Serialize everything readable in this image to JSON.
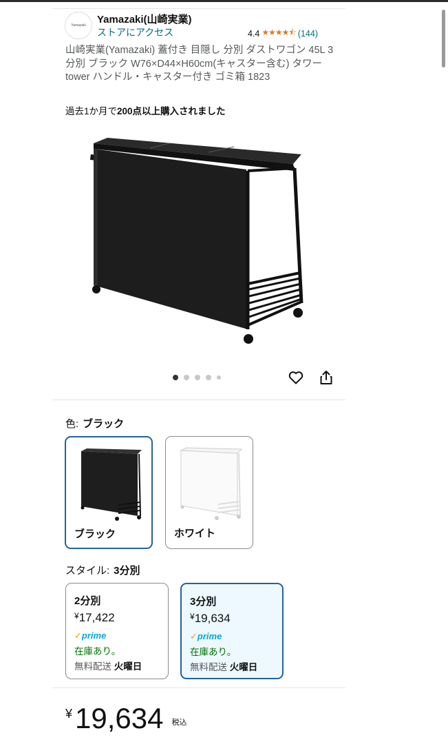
{
  "brand": {
    "logo_text": "Yamazaki",
    "name": "Yamazaki(山崎実業)",
    "store_link": "ストアにアクセス"
  },
  "rating": {
    "value": "4.4",
    "stars": "★★★★⯪",
    "count": "(144)"
  },
  "product": {
    "title": "山崎実業(Yamazaki) 蓋付き 目隠し 分別 ダストワゴン 45L 3分別 ブラック W76×D44×H60cm(キャスター含む) タワー tower ハンドル・キャスター付き ゴミ箱 1823",
    "bought_prefix": "過去1か月で",
    "bought_bold": "200点以上購入されました"
  },
  "carousel": {
    "total": 5,
    "active": 0
  },
  "color": {
    "label": "色:",
    "selected": "ブラック",
    "options": [
      {
        "label": "ブラック",
        "color": "#1e1e1e",
        "selected": true
      },
      {
        "label": "ホワイト",
        "color": "#ffffff",
        "selected": false
      }
    ]
  },
  "style": {
    "label": "スタイル:",
    "selected": "3分別",
    "options": [
      {
        "name": "2分別",
        "yen": "¥",
        "price": "17,422",
        "prime": "prime",
        "stock": "在庫あり。",
        "ship_prefix": "無料配送 ",
        "ship_day": "火曜日",
        "selected": false
      },
      {
        "name": "3分別",
        "yen": "¥",
        "price": "19,634",
        "prime": "prime",
        "stock": "在庫あり。",
        "ship_prefix": "無料配送 ",
        "ship_day": "火曜日",
        "selected": true
      }
    ]
  },
  "price": {
    "yen": "¥",
    "amount": "19,634",
    "tax": "税込"
  },
  "colors": {
    "link": "#007185",
    "star": "#de7921",
    "stock": "#007600",
    "prime": "#00a8e1",
    "selected_border": "#2162a1"
  }
}
